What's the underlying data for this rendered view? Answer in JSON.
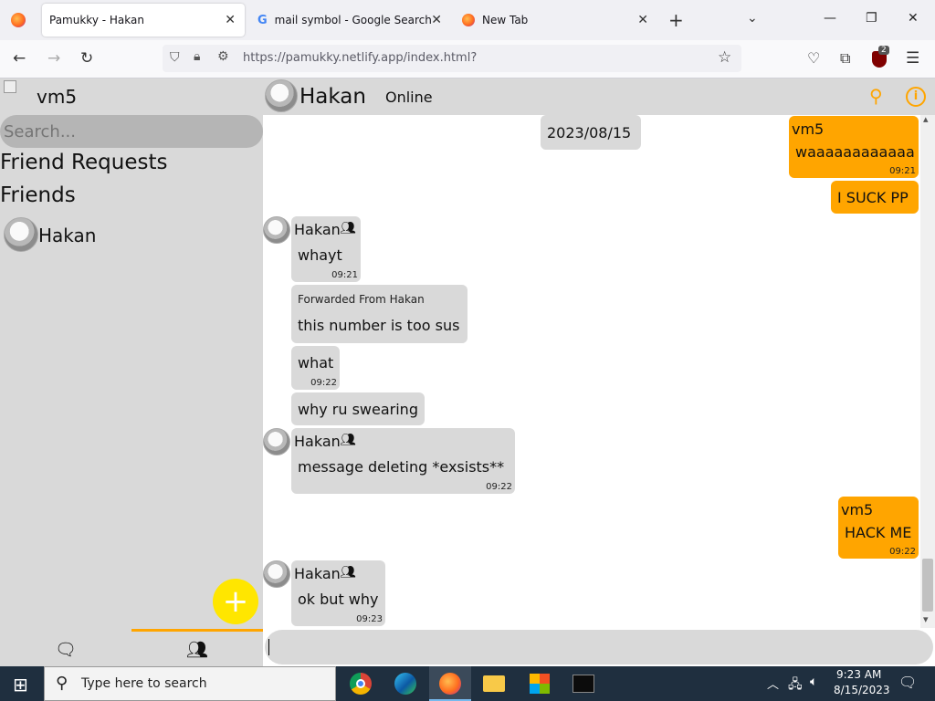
{
  "browser": {
    "tabs": [
      {
        "title": "Pamukky - Hakan",
        "icon": "firefox-icon"
      },
      {
        "title": "mail symbol - Google Search",
        "icon": "google-icon"
      },
      {
        "title": "New Tab",
        "icon": "firefox-icon"
      }
    ],
    "new_tab_symbol": "+",
    "url": "https://pamukky.netlify.app/index.html?",
    "extension_badge": "2"
  },
  "sidebar": {
    "username": "vm5",
    "search_placeholder": "Search...",
    "friend_requests_label": "Friend Requests",
    "friends_label": "Friends",
    "friends": [
      {
        "name": "Hakan"
      }
    ],
    "fab_symbol": "+"
  },
  "chat": {
    "contact_name": "Hakan",
    "status": "Online",
    "date_label": "2023/08/15",
    "messages": [
      {
        "dir": "out",
        "sender": "vm5",
        "text": "waaaaaaaaaaaa",
        "time": "09:21"
      },
      {
        "dir": "out",
        "sender": "",
        "text": "I SUCK PP",
        "time": ""
      },
      {
        "dir": "in",
        "sender": "Hakan",
        "text": "whayt",
        "time": "09:21"
      },
      {
        "dir": "in",
        "forwarded": "Forwarded From Hakan",
        "text": "this number is too sus",
        "time": ""
      },
      {
        "dir": "in",
        "sender": "",
        "text": "what",
        "time": "09:22"
      },
      {
        "dir": "in",
        "sender": "",
        "text": "why ru swearing",
        "time": ""
      },
      {
        "dir": "in",
        "sender": "Hakan",
        "text": "message deleting *exsists**",
        "time": "09:22"
      },
      {
        "dir": "out",
        "sender": "vm5",
        "text": "HACK ME",
        "time": "09:22"
      },
      {
        "dir": "in",
        "sender": "Hakan",
        "text": "ok but why",
        "time": "09:23"
      }
    ]
  },
  "taskbar": {
    "search_placeholder": "Type here to search",
    "time": "9:23 AM",
    "date": "8/15/2023"
  },
  "colors": {
    "accent": "#ffa500",
    "fab": "#ffe600",
    "panel": "#d9d9d9"
  }
}
